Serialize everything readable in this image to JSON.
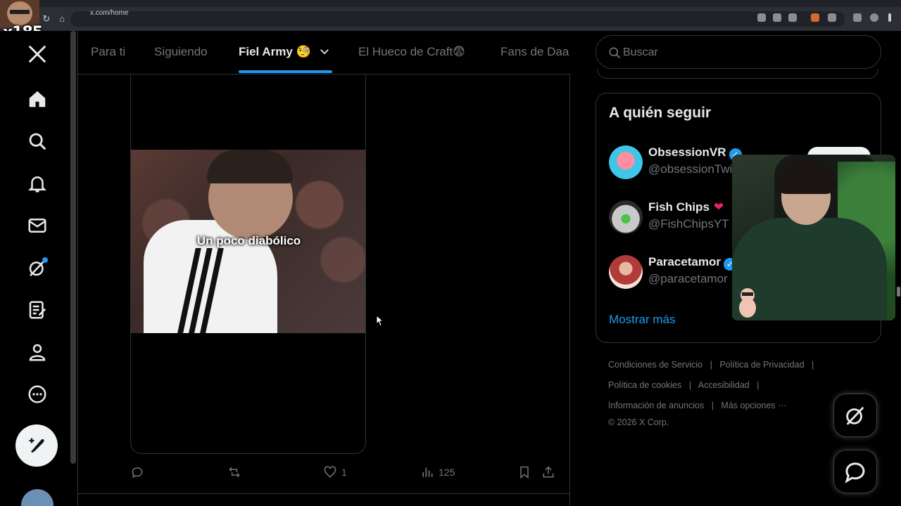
{
  "browser": {
    "url": "x.com/home"
  },
  "overlay": {
    "multiplier": "x185"
  },
  "tabs": [
    {
      "label": "Para ti"
    },
    {
      "label": "Siguiendo"
    },
    {
      "label": "Fiel Army 🧐"
    },
    {
      "label": "El Hueco de Craft😨"
    },
    {
      "label": "Fans de Daa"
    }
  ],
  "post": {
    "video_caption": "Un poco diabólico",
    "likes": "1",
    "views": "125"
  },
  "search": {
    "placeholder": "Buscar"
  },
  "who_to_follow": {
    "title": "A quién seguir",
    "accounts": [
      {
        "name": "ObsessionVR",
        "handle": "@obsessionTwi",
        "verified": true
      },
      {
        "name": "Fish Chips",
        "handle": "@FishChipsYT",
        "verified": false
      },
      {
        "name": "Paracetamor",
        "handle": "@paracetamor",
        "verified": true
      }
    ],
    "show_more": "Mostrar más"
  },
  "footer": {
    "terms": "Condiciones de Servicio",
    "privacy": "Política de Privacidad",
    "cookies": "Política de cookies",
    "accessibility": "Accesibilidad",
    "ads_info": "Información de anuncios",
    "more_options": "Más opciones ···",
    "copyright": "© 2026 X Corp."
  },
  "colors": {
    "accent": "#1d9bf0",
    "background": "#000000",
    "text_primary": "#e7e9ea",
    "text_secondary": "#71767b",
    "border": "#2f3336"
  }
}
